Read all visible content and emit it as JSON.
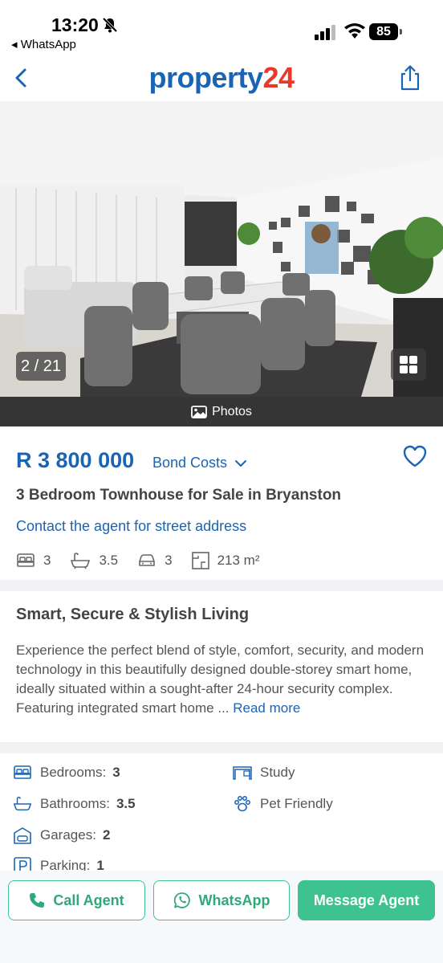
{
  "status_bar": {
    "time": "13:20",
    "back_app": "◂ WhatsApp",
    "battery": "85"
  },
  "header": {
    "logo_part1": "property",
    "logo_part2": "24"
  },
  "gallery": {
    "counter": "2 / 21",
    "photos_label": "Photos"
  },
  "listing": {
    "price": "R 3 800 000",
    "bond_costs": "Bond Costs",
    "title": "3 Bedroom Townhouse for Sale in Bryanston",
    "contact": "Contact the agent for street address",
    "quick_stats": {
      "bedrooms": "3",
      "bathrooms": "3.5",
      "garages": "3",
      "size": "213 m²"
    }
  },
  "description": {
    "heading": "Smart, Secure & Stylish Living",
    "text": "Experience the perfect blend of style, comfort, security, and modern technology in this beautifully designed double-storey smart home, ideally situated within a sought-after 24-hour security complex. Featuring integrated smart home ... ",
    "read_more": "Read more"
  },
  "features": {
    "bedrooms_label": "Bedrooms:",
    "bedrooms_value": "3",
    "bathrooms_label": "Bathrooms:",
    "bathrooms_value": "3.5",
    "garages_label": "Garages:",
    "garages_value": "2",
    "parking_label": "Parking:",
    "parking_value": "1",
    "study": "Study",
    "pet_friendly": "Pet Friendly"
  },
  "actions": {
    "call": "Call Agent",
    "whatsapp": "WhatsApp",
    "message": "Message Agent"
  },
  "colors": {
    "brand_blue": "#1a64b5",
    "brand_red": "#e8392b",
    "action_green": "#3ec28f"
  }
}
